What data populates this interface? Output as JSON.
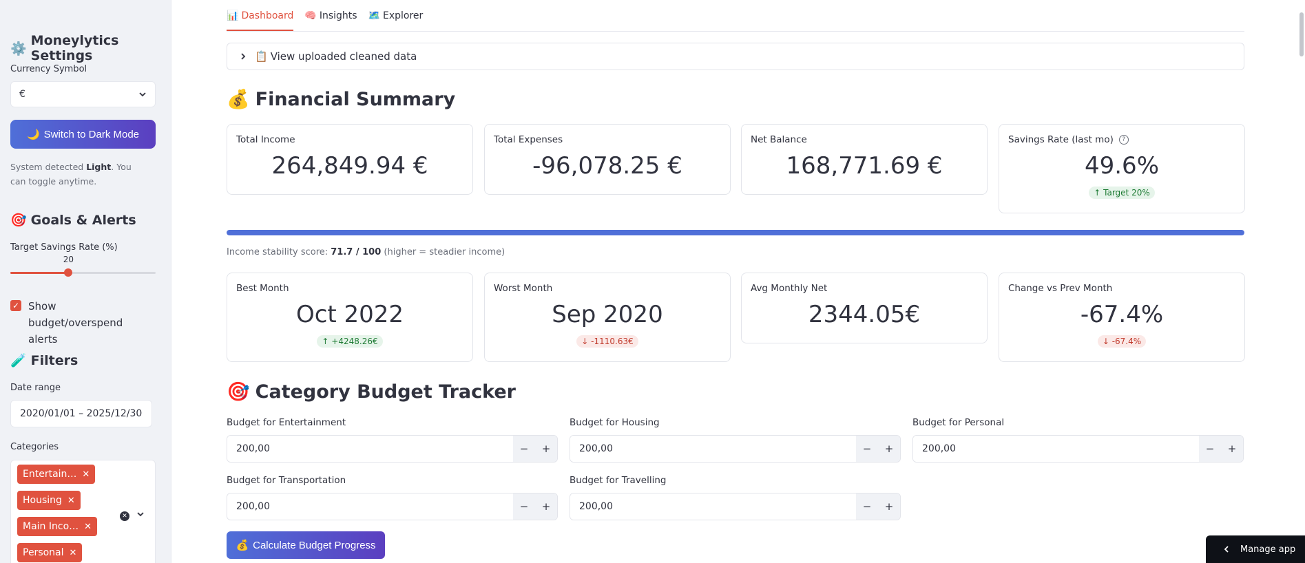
{
  "sidebar": {
    "settings_title": "Moneylytics Settings",
    "settings_icon": "⚙️",
    "currency_label": "Currency Symbol",
    "currency_value": "€",
    "dark_mode_button": "Switch to Dark Mode",
    "hint_prefix": "System detected ",
    "hint_mode": "Light",
    "hint_suffix": ". You can toggle anytime.",
    "goals_title": "Goals & Alerts",
    "goals_icon": "🎯",
    "target_label": "Target Savings Rate (%)",
    "target_value": "20",
    "target_fraction": 0.4,
    "alerts_label": "Show budget/overspend alerts",
    "filters_title": "Filters",
    "filters_icon": "🧪",
    "date_label": "Date range",
    "date_value": "2020/01/01 – 2025/12/30",
    "categories_label": "Categories",
    "categories": [
      "Entertain…",
      "Housing",
      "Main Inco…",
      "Personal"
    ]
  },
  "tabs": [
    {
      "icon": "📊",
      "label": "Dashboard"
    },
    {
      "icon": "🧠",
      "label": "Insights"
    },
    {
      "icon": "🗺️",
      "label": "Explorer"
    }
  ],
  "expander": {
    "icon": "📋",
    "label": "View uploaded cleaned data"
  },
  "financial_summary": {
    "icon": "💰",
    "title": "Financial Summary",
    "metrics": [
      {
        "label": "Total Income",
        "value": "264,849.94 €"
      },
      {
        "label": "Total Expenses",
        "value": "-96,078.25 €"
      },
      {
        "label": "Net Balance",
        "value": "168,771.69 €"
      },
      {
        "label": "Savings Rate (last mo)",
        "value": "49.6%",
        "delta": "Target 20%"
      }
    ],
    "stability_fraction": 1.0,
    "stability_prefix": "Income stability score: ",
    "stability_score": "71.7 / 100",
    "stability_suffix": " (higher = steadier income)"
  },
  "monthly_metrics": [
    {
      "label": "Best Month",
      "value": "Oct 2022",
      "delta": "+4248.26€",
      "direction": "up"
    },
    {
      "label": "Worst Month",
      "value": "Sep 2020",
      "delta": "-1110.63€",
      "direction": "down"
    },
    {
      "label": "Avg Monthly Net",
      "value": "2344.05€"
    },
    {
      "label": "Change vs Prev Month",
      "value": "-67.4%",
      "delta": "-67.4%",
      "direction": "down"
    }
  ],
  "budget_tracker": {
    "icon": "🎯",
    "title": "Category Budget Tracker",
    "budgets": [
      {
        "label": "Budget for Entertainment",
        "value": "200,00"
      },
      {
        "label": "Budget for Housing",
        "value": "200,00"
      },
      {
        "label": "Budget for Personal",
        "value": "200,00"
      },
      {
        "label": "Budget for Transportation",
        "value": "200,00"
      },
      {
        "label": "Budget for Travelling",
        "value": "200,00"
      }
    ],
    "calc_icon": "💰",
    "calc_button": "Calculate Budget Progress"
  },
  "manage_app": "Manage app",
  "colors": {
    "accent": "#e0523f",
    "primary": "#4f6fd8",
    "sidebar_bg": "#f0f2f6"
  }
}
